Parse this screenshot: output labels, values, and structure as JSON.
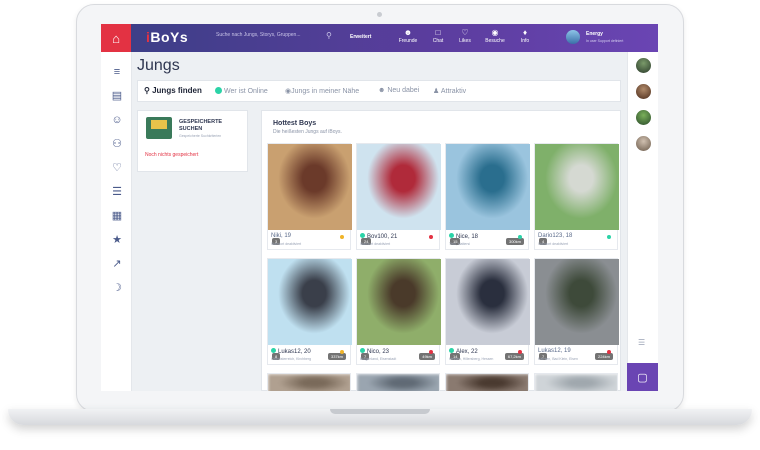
{
  "app": {
    "logo_prefix": "i",
    "logo_suffix": "BoYs"
  },
  "topbar": {
    "search_placeholder": "Suche nach Jungs, Storys, Gruppen...",
    "erweitert": "Erweitert",
    "nav": [
      {
        "label": "Freunde",
        "icon": "user-icon"
      },
      {
        "label": "Chat",
        "icon": "chat-icon"
      },
      {
        "label": "Likes",
        "icon": "heart-icon"
      },
      {
        "label": "Besuche",
        "icon": "eye-icon"
      },
      {
        "label": "Info",
        "icon": "bell-icon"
      }
    ],
    "user": {
      "name": "Energy",
      "status": "In user Support definiert"
    }
  },
  "page": {
    "title": "Jungs"
  },
  "tabs": [
    {
      "label": "Jungs finden",
      "icon": "search-icon"
    },
    {
      "label": "Wer ist Online",
      "icon": "online-dot-icon"
    },
    {
      "label": "Jungs in meiner Nähe",
      "icon": "location-pin-icon"
    },
    {
      "label": "Neu dabei",
      "icon": "add-user-icon"
    },
    {
      "label": "Attraktiv",
      "icon": "person-icon"
    }
  ],
  "saved_searches": {
    "heading": "GESPEICHERTE SUCHEN",
    "subtext": "Gespeicherte Suchkriterien",
    "empty": "Noch nichts gespeichert"
  },
  "hottest": {
    "heading": "Hottest Boys",
    "subtext": "Die heißesten Jungs auf iBoys.",
    "cards": [
      {
        "name": "Niki, 19",
        "online": false,
        "photos": "3",
        "dist": "",
        "loc": "Standort deaktiviert",
        "flag": "#f0b429",
        "c1": "#c9a070",
        "c2": "#6b3a2a"
      },
      {
        "name": "Bov100, 21",
        "online": true,
        "photos": "24",
        "dist": "",
        "loc": "Standort deaktiviert",
        "flag": "#e33243",
        "c1": "#cfe3ef",
        "c2": "#b02a3a"
      },
      {
        "name": "Nice, 18",
        "online": true,
        "photos": "15",
        "dist": "300km",
        "loc": "Tirol, Mattersi",
        "flag": "#2bd3a7",
        "c1": "#9ac4de",
        "c2": "#2a6e8e"
      },
      {
        "name": "Dario123, 18",
        "online": false,
        "photos": "4",
        "dist": "",
        "loc": "Standort deaktiviert",
        "flag": "#2bd3a7",
        "c1": "#7fb06a",
        "c2": "#d5d9d2"
      },
      {
        "name": "Lukas12, 20",
        "online": true,
        "photos": "8",
        "dist": "337km",
        "loc": "Oberösterreich, Kirchberg",
        "flag": "#f0b429",
        "c1": "#bfe0f0",
        "c2": "#3a3f4a"
      },
      {
        "name": "Nico, 23",
        "online": true,
        "photos": "7",
        "dist": "49km",
        "loc": "Burgenland, Eisenstadt",
        "flag": "#e33243",
        "c1": "#8fae6a",
        "c2": "#4a3a2a"
      },
      {
        "name": "Alex, 22",
        "online": true,
        "photos": "14",
        "dist": "67,2km",
        "loc": "Hessen, Hillersberg, Hessen",
        "flag": "#e33243",
        "c1": "#c8ccd6",
        "c2": "#2a2f3e"
      },
      {
        "name": "Lukas12, 19",
        "online": false,
        "photos": "7",
        "dist": "224km",
        "loc": "Kärnten, Bad Klein, Eisen",
        "flag": "#e33243",
        "c1": "#8a8e92",
        "c2": "#3e4a3a"
      },
      {
        "name": "",
        "online": false,
        "photos": "",
        "dist": "",
        "loc": "",
        "flag": "transparent",
        "c1": "#b0a090",
        "c2": "#7a6a5a"
      },
      {
        "name": "",
        "online": false,
        "photos": "",
        "dist": "",
        "loc": "",
        "flag": "transparent",
        "c1": "#9aa5b0",
        "c2": "#606a75"
      },
      {
        "name": "",
        "online": false,
        "photos": "",
        "dist": "",
        "loc": "",
        "flag": "transparent",
        "c1": "#8a7a70",
        "c2": "#4a3a30"
      },
      {
        "name": "",
        "online": false,
        "photos": "",
        "dist": "",
        "loc": "",
        "flag": "transparent",
        "c1": "#cfd4d8",
        "c2": "#a0a8ae"
      }
    ]
  },
  "sidebar_icons": [
    "menu-icon",
    "id-card-icon",
    "user-icon",
    "group-icon",
    "heart-icon",
    "list-icon",
    "calendar-icon",
    "star-icon",
    "chart-icon",
    "moon-icon"
  ],
  "online_friends": [
    {
      "c1": "#7a9a6a",
      "c2": "#2a3a2a"
    },
    {
      "c1": "#b08a6a",
      "c2": "#4a2a1a"
    },
    {
      "c1": "#7ab05a",
      "c2": "#2a4a2a"
    },
    {
      "c1": "#d0c0b0",
      "c2": "#6a5a4a"
    }
  ]
}
